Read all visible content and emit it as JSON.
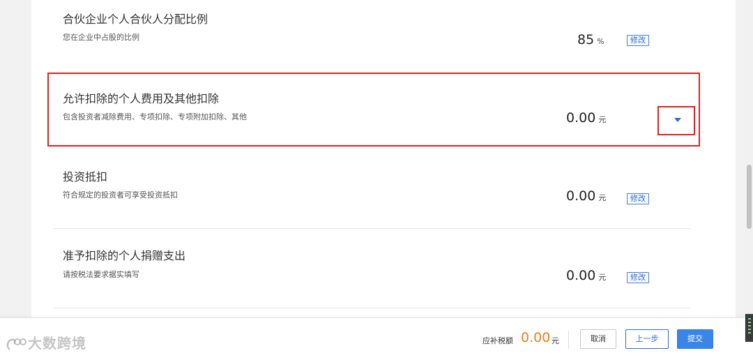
{
  "rows": [
    {
      "title": "合伙企业个人合伙人分配比例",
      "desc": "您在企业中占股的比例",
      "amount": "85",
      "unit": "%",
      "action": "修改"
    },
    {
      "title": "允许扣除的个人费用及其他扣除",
      "desc": "包含投资者减除费用、专项扣除、专项附加扣除、其他",
      "amount": "0.00",
      "unit": "元",
      "action_icon": "caret-down-icon"
    },
    {
      "title": "投资抵扣",
      "desc": "符合规定的投资者可享受投资抵扣",
      "amount": "0.00",
      "unit": "元",
      "action": "修改"
    },
    {
      "title": "准予扣除的个人捐赠支出",
      "desc": "请按税法要求据实填写",
      "amount": "0.00",
      "unit": "元",
      "action": "修改"
    }
  ],
  "footer": {
    "label": "应补税额",
    "amount": "0.00",
    "unit": "元",
    "cancel": "取消",
    "prev": "上一步",
    "submit": "提交"
  },
  "watermark": {
    "text": "大数跨境",
    "icon": "logo-icon"
  },
  "colors": {
    "accent": "#2f6bd1",
    "amount_orange": "#f07c1a",
    "highlight_red": "#e02020",
    "submit_blue": "#3a86e8"
  }
}
